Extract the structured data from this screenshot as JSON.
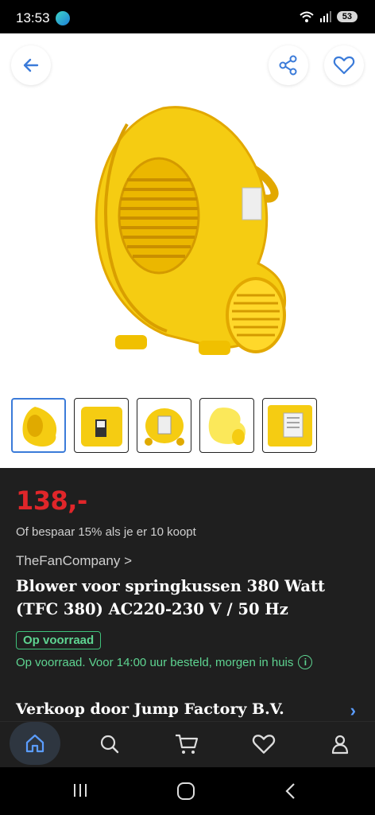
{
  "status_bar": {
    "time": "13:53",
    "battery": "53"
  },
  "product": {
    "price": "138,-",
    "discount_text": "Of bespaar 15% als je er 10 koopt",
    "brand_link": "TheFanCompany >",
    "title": "Blower voor springkussen 380 Watt (TFC 380) AC220-230 V / 50 Hz",
    "stock_badge": "Op voorraad",
    "delivery_text": "Op voorraad. Voor 14:00 uur besteld, morgen in huis",
    "seller_text": "Verkoop door Jump Factory B.V."
  },
  "thumbnails": [
    {
      "label": "thumbnail-1",
      "active": true
    },
    {
      "label": "thumbnail-2",
      "active": false
    },
    {
      "label": "thumbnail-3",
      "active": false
    },
    {
      "label": "thumbnail-4",
      "active": false
    },
    {
      "label": "thumbnail-5",
      "active": false
    }
  ],
  "colors": {
    "price": "#e0262a",
    "stock": "#5ed491",
    "accent": "#3b7bd9",
    "product_yellow": "#f5cc12"
  },
  "icons": {
    "back": "arrow-left-icon",
    "share": "share-icon",
    "favorite": "heart-icon",
    "nav": [
      "home-icon",
      "search-icon",
      "cart-icon",
      "heart-icon",
      "user-icon"
    ]
  }
}
